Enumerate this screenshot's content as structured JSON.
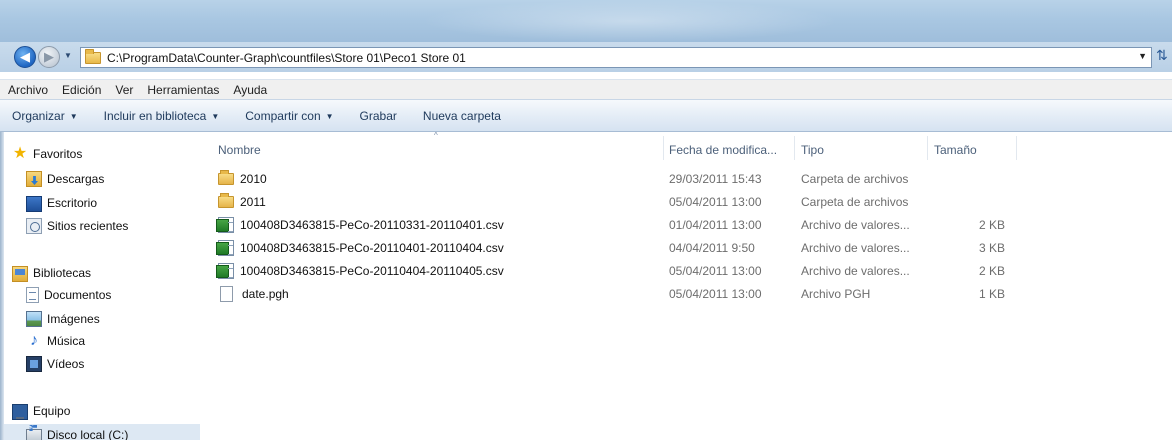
{
  "window": {
    "address_path": "C:\\ProgramData\\Counter-Graph\\countfiles\\Store 01\\Peco1 Store 01"
  },
  "icons": {
    "back": "back-arrow-icon",
    "forward": "forward-arrow-icon",
    "refresh": "refresh-icon"
  },
  "menubar": {
    "items": [
      "Archivo",
      "Edición",
      "Ver",
      "Herramientas",
      "Ayuda"
    ]
  },
  "toolbar": {
    "organize": "Organizar",
    "include_library": "Incluir en biblioteca",
    "share_with": "Compartir con",
    "burn": "Grabar",
    "new_folder": "Nueva carpeta"
  },
  "sidebar": {
    "favorites": "Favoritos",
    "downloads": "Descargas",
    "desktop": "Escritorio",
    "recent": "Sitios recientes",
    "libraries": "Bibliotecas",
    "documents": "Documentos",
    "images": "Imágenes",
    "music": "Música",
    "videos": "Vídeos",
    "computer": "Equipo",
    "local_disk": "Disco local (C:)"
  },
  "columns": {
    "name": "Nombre",
    "date": "Fecha de modifica...",
    "type": "Tipo",
    "size": "Tamaño"
  },
  "files": [
    {
      "name": "2010",
      "date": "29/03/2011 15:43",
      "type": "Carpeta de archivos",
      "size": "",
      "icon": "folder-icon"
    },
    {
      "name": "2011",
      "date": "05/04/2011 13:00",
      "type": "Carpeta de archivos",
      "size": "",
      "icon": "folder-icon"
    },
    {
      "name": "100408D3463815-PeCo-20110331-20110401.csv",
      "date": "01/04/2011 13:00",
      "type": "Archivo de valores...",
      "size": "2 KB",
      "icon": "csv-file-icon"
    },
    {
      "name": "100408D3463815-PeCo-20110401-20110404.csv",
      "date": "04/04/2011 9:50",
      "type": "Archivo de valores...",
      "size": "3 KB",
      "icon": "csv-file-icon"
    },
    {
      "name": "100408D3463815-PeCo-20110404-20110405.csv",
      "date": "05/04/2011 13:00",
      "type": "Archivo de valores...",
      "size": "2 KB",
      "icon": "csv-file-icon"
    },
    {
      "name": "date.pgh",
      "date": "05/04/2011 13:00",
      "type": "Archivo PGH",
      "size": "1 KB",
      "icon": "file-icon"
    }
  ]
}
